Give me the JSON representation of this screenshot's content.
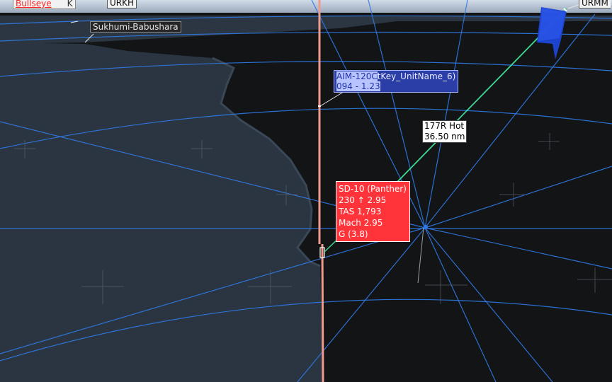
{
  "labels": {
    "bullseye": "Bullseye",
    "bullseye_suffix": "K",
    "urkh": "URKH",
    "sukhumi": "Sukhumi-Babushara",
    "urmm": "URMM"
  },
  "missile": {
    "line1_a": "AIM-120C",
    "line1_b": "tKey_UnitName_6)",
    "line2": "094 - 1.23"
  },
  "range_label": {
    "line1": "177R Hot",
    "line2": "36.50 nm"
  },
  "target": {
    "name": "SD-10 (Panther)",
    "heading_alt": "230 ↑ 2.95",
    "tas": "TAS 1,793",
    "mach": "Mach 2.95",
    "g": "G (3.8)"
  },
  "colors": {
    "sky": "#a9b7c9",
    "water": "#2a3541",
    "land": "#141618",
    "grid_line": "#2f7ae6",
    "missile_track": "#f19a8c",
    "target_box": "#ff343a",
    "range_line": "#3fd792",
    "friendly_marker": "#1e46d6"
  },
  "icons": {
    "bullseye": "bullseye-icon",
    "friendly": "friendly-aircraft-icon",
    "target": "target-symbol-icon"
  }
}
